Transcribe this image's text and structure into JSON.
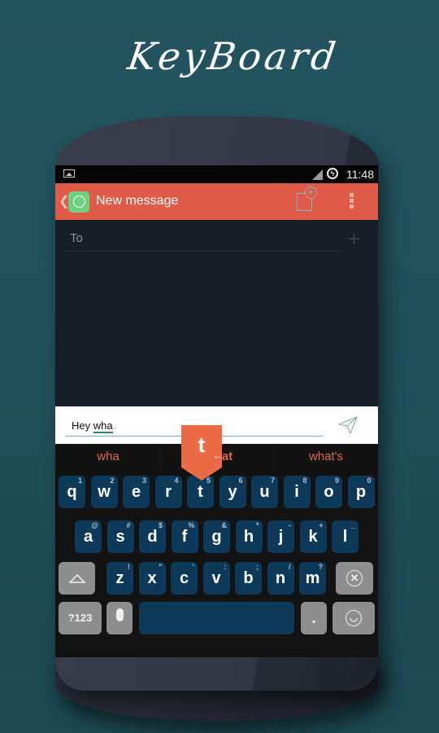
{
  "promo_title": "KeyBoard",
  "status_bar": {
    "time": "11:48",
    "icons": [
      "image-icon",
      "signal-icon",
      "power-saving-icon"
    ]
  },
  "app_bar": {
    "back_icon": "chevron-left-icon",
    "app_icon": "chat-bubble-icon",
    "title": "New message",
    "actions": [
      "compose-add-icon",
      "more-vert-icon"
    ]
  },
  "recipient": {
    "label": "To",
    "add_icon": "plus-icon"
  },
  "message": {
    "typed_prefix": "Hey ",
    "typed_word": "wha",
    "send_icon": "paper-plane-icon"
  },
  "suggestions": [
    "wha",
    "what",
    "what's"
  ],
  "key_preview": {
    "letter": "t",
    "more": "..."
  },
  "keyboard": {
    "row1": [
      {
        "k": "q",
        "s": "1"
      },
      {
        "k": "w",
        "s": "2"
      },
      {
        "k": "e",
        "s": "3"
      },
      {
        "k": "r",
        "s": "4"
      },
      {
        "k": "t",
        "s": "5"
      },
      {
        "k": "y",
        "s": "6"
      },
      {
        "k": "u",
        "s": "7"
      },
      {
        "k": "i",
        "s": "8"
      },
      {
        "k": "o",
        "s": "9"
      },
      {
        "k": "p",
        "s": "0"
      }
    ],
    "row2": [
      {
        "k": "a",
        "s": "@"
      },
      {
        "k": "s",
        "s": "#"
      },
      {
        "k": "d",
        "s": "$"
      },
      {
        "k": "f",
        "s": "%"
      },
      {
        "k": "g",
        "s": "&"
      },
      {
        "k": "h",
        "s": "*"
      },
      {
        "k": "j",
        "s": "-"
      },
      {
        "k": "k",
        "s": "+"
      },
      {
        "k": "l",
        "s": "_"
      }
    ],
    "row3": [
      {
        "k": "z",
        "s": "!"
      },
      {
        "k": "x",
        "s": "\""
      },
      {
        "k": "c",
        "s": "'"
      },
      {
        "k": "v",
        "s": ":"
      },
      {
        "k": "b",
        "s": ";"
      },
      {
        "k": "n",
        "s": "/"
      },
      {
        "k": "m",
        "s": "?"
      }
    ],
    "symbols_label": "?123",
    "period_label": ".",
    "shift_icon": "shift-icon",
    "backspace_icon": "delete-icon",
    "mic_icon": "microphone-icon",
    "emoji_icon": "emoji-icon"
  },
  "colors": {
    "accent": "#e05a48",
    "key": "#0d3a5b",
    "background": "#235560"
  }
}
